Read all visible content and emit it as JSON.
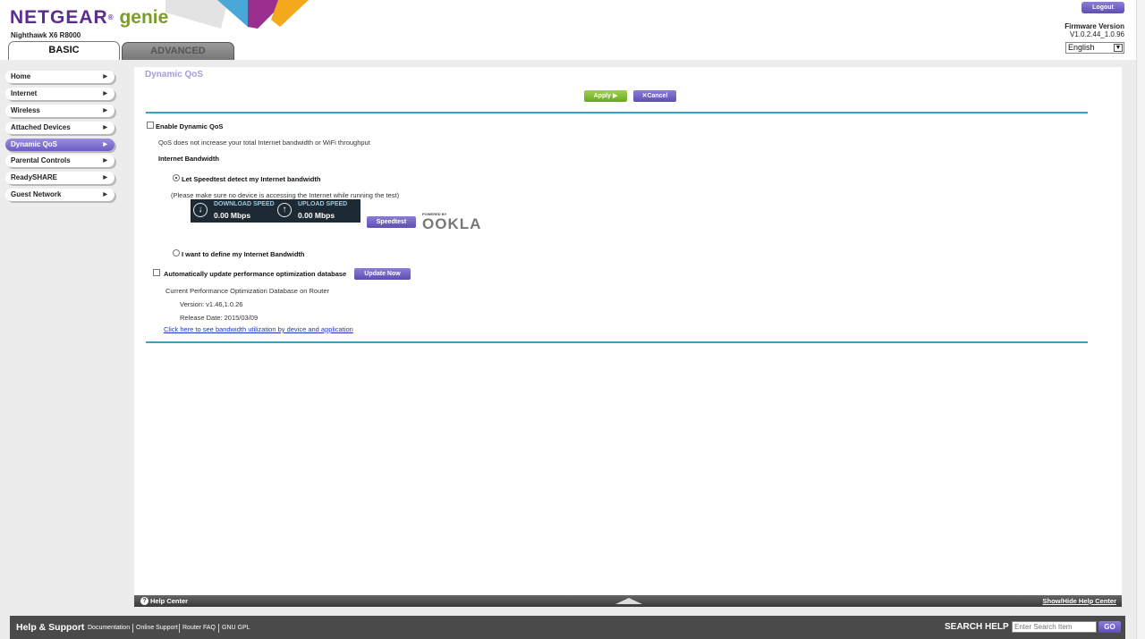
{
  "header": {
    "logo_brand": "NETGEAR",
    "logo_reg": "®",
    "logo_genie": "genie",
    "model": "Nighthawk X6 R8000",
    "tabs": [
      {
        "label": "BASIC",
        "active": true
      },
      {
        "label": "ADVANCED",
        "active": false
      }
    ],
    "logout_label": "Logout",
    "firmware_label": "Firmware Version",
    "firmware_value": "V1.0.2.44_1.0.96",
    "language": "English",
    "banner_colors": [
      "#d5d5d5",
      "#4aa8d8",
      "#9a2f8f",
      "#f4a81c"
    ]
  },
  "sidebar": {
    "items": [
      {
        "label": "Home",
        "active": false
      },
      {
        "label": "Internet",
        "active": false
      },
      {
        "label": "Wireless",
        "active": false
      },
      {
        "label": "Attached Devices",
        "active": false
      },
      {
        "label": "Dynamic QoS",
        "active": true
      },
      {
        "label": "Parental Controls",
        "active": false
      },
      {
        "label": "ReadySHARE",
        "active": false
      },
      {
        "label": "Guest Network",
        "active": false
      }
    ]
  },
  "content": {
    "title": "Dynamic QoS",
    "apply_label": "Apply ▶",
    "cancel_label": "✕Cancel",
    "enable_qos_label": "Enable Dynamic QoS",
    "enable_qos_checked": false,
    "qos_note": "QoS does not increase your total Internet bandwidth or WiFi throughput",
    "bandwidth_heading": "Internet Bandwidth",
    "speedtest_option_label": "Let Speedtest detect my Internet bandwidth",
    "speedtest_option_selected": true,
    "speedtest_note": "(Please make sure no device is accessing the Internet while running the test)",
    "download_label": "DOWNLOAD SPEED",
    "download_value": "0.00 Mbps",
    "upload_label": "UPLOAD SPEED",
    "upload_value": "0.00 Mbps",
    "speedtest_button": "Speedtest",
    "ookla_small": "POWERED BY",
    "ookla_big": "OOKLA",
    "manual_option_label": "I want to define my Internet Bandwidth",
    "manual_option_selected": false,
    "auto_update_label": "Automatically update performance optimization database",
    "auto_update_checked": false,
    "update_button": "Update Now",
    "db_heading": "Current Performance Optimization Database on Router",
    "db_version": "Version: v1.46,1.0.26",
    "db_release": "Release Date: 2015/03/09",
    "bandwidth_link": "Click here to see bandwidth utilization by device and application"
  },
  "help_bar": {
    "title": "Help Center",
    "toggle_label": "Show/Hide Help Center"
  },
  "footer": {
    "title": "Help & Support",
    "links": [
      "Documentation",
      "Online Support",
      "Router FAQ",
      "GNU GPL"
    ],
    "search_label": "SEARCH HELP",
    "search_placeholder": "Enter Search Item",
    "go_label": "GO"
  }
}
